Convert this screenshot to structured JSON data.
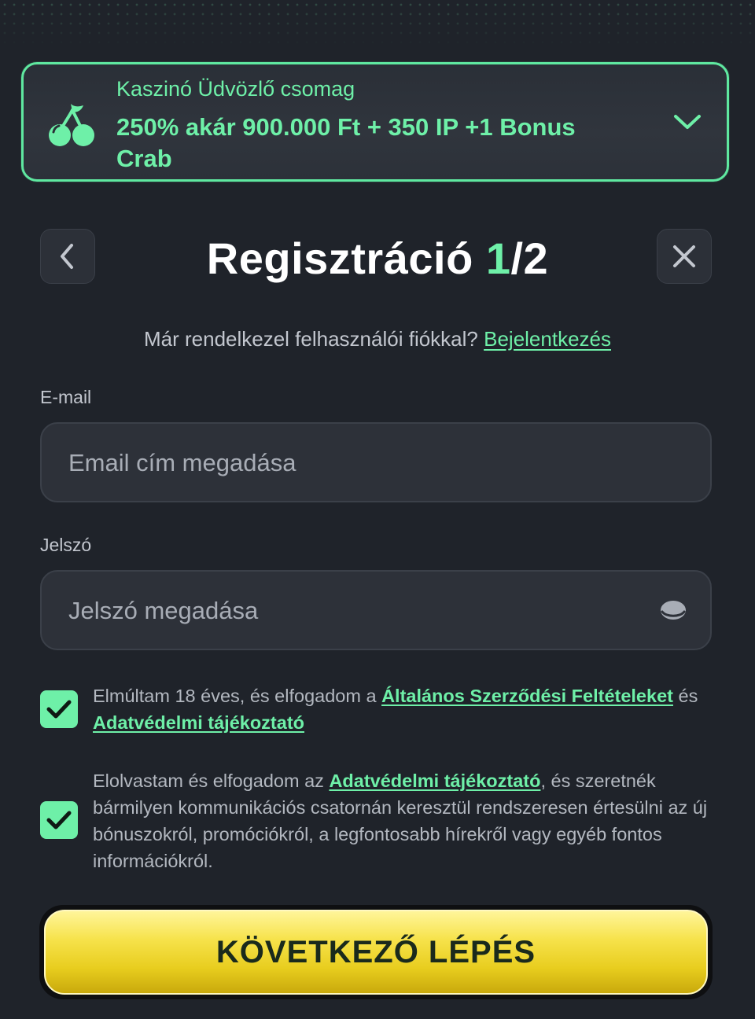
{
  "promo": {
    "subtitle": "Kaszinó Üdvözlő csomag",
    "title": "250% akár 900.000 Ft + 350 IP +1 Bonus Crab",
    "icon": "cherry-icon"
  },
  "header": {
    "title": "Regisztráció",
    "step_current": "1",
    "step_total": "/2",
    "back_icon": "chevron-left-icon",
    "close_icon": "close-icon"
  },
  "login": {
    "prompt": "Már rendelkezel felhasználói fiókkal?",
    "link": "Bejelentkezés"
  },
  "email": {
    "label": "E-mail",
    "placeholder": "Email cím megadása",
    "value": ""
  },
  "password": {
    "label": "Jelszó",
    "placeholder": "Jelszó megadása",
    "value": ""
  },
  "consents": [
    {
      "checked": true,
      "text_before": "Elmúltam 18 éves, és elfogadom a ",
      "link1": "Általános Szerződési Feltételeket",
      "text_mid": " és ",
      "link2": "Adatvédelmi tájékoztató"
    },
    {
      "checked": true,
      "text_before": "Elolvastam és elfogadom az ",
      "link1": "Adatvédelmi tájékoztató",
      "text_after": ", és szeretnék bármilyen kommunikációs csatornán keresztül rendszeresen értesülni az új bónuszokról, promóciókról, a legfontosabb hírekről vagy egyéb fontos információkról."
    }
  ],
  "cta": {
    "label": "KÖVETKEZŐ LÉPÉS"
  },
  "colors": {
    "accent": "#6ef0a8",
    "background": "#1f232a",
    "cta": "#f6e24a"
  }
}
